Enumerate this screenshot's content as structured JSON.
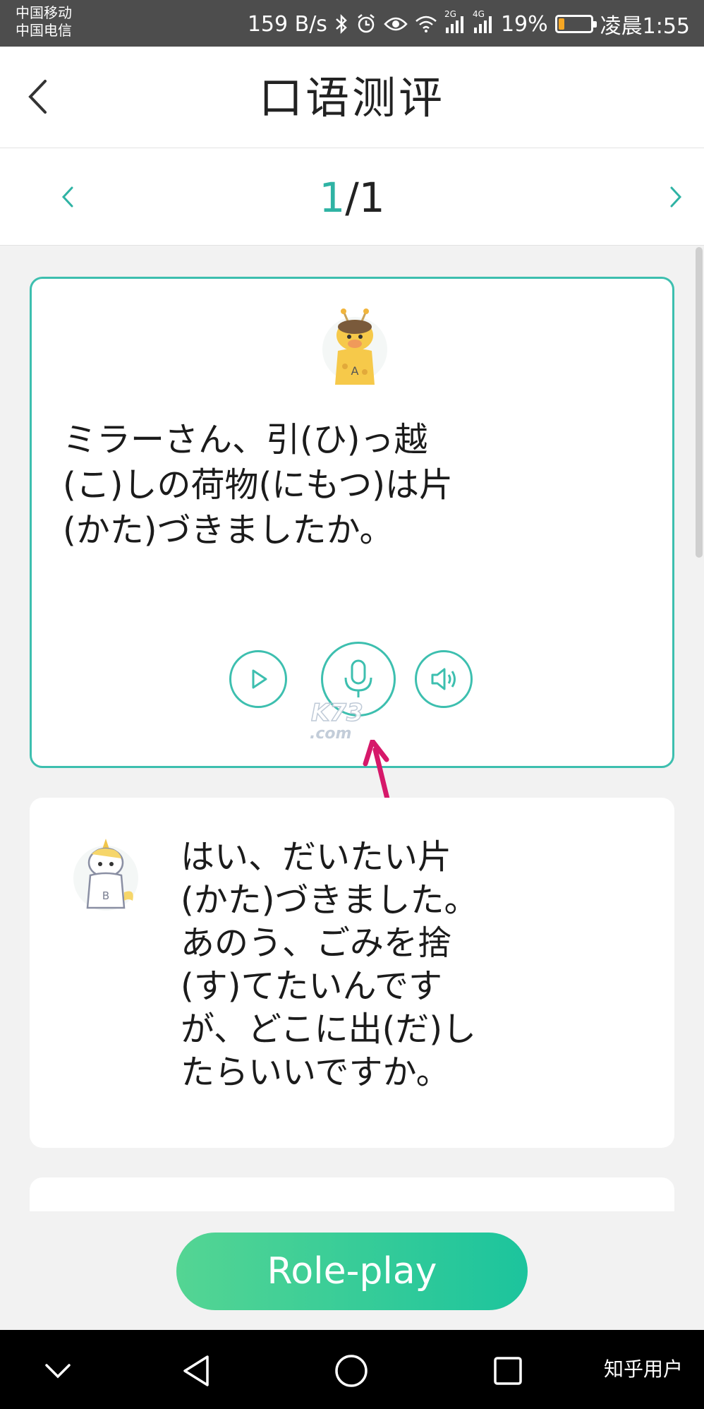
{
  "status_bar": {
    "carrier_1": "中国移动",
    "carrier_2": "中国电信",
    "speed": "159 B/s",
    "network_1": "2G",
    "network_2": "4G",
    "battery_percent": "19%",
    "battery_level": 0.19,
    "time": "凌晨1:55",
    "icons": [
      "bluetooth-icon",
      "alarm-icon",
      "eye-icon",
      "wifi-icon",
      "signal-icon",
      "battery-icon"
    ]
  },
  "header": {
    "title": "口语测评"
  },
  "pager": {
    "current": "1",
    "separator": "/",
    "total": "1"
  },
  "dialog": [
    {
      "speaker": "A",
      "text_lines": [
        "ミラーさん、引(ひ)っ越",
        "(こ)しの荷物(にもつ)は片",
        "(かた)づきましたか。"
      ],
      "selected": true
    },
    {
      "speaker": "B",
      "text_lines": [
        "はい、だいたい片",
        "(かた)づきました。",
        "あのう、ごみを捨",
        "(す)てたいんです",
        "が、どこに出(だ)し",
        "たらいいですか。"
      ],
      "selected": false
    }
  ],
  "controls": {
    "icons": [
      "play-icon",
      "microphone-icon",
      "speaker-icon"
    ]
  },
  "watermark": {
    "logo": "K73",
    "site": ".com"
  },
  "bottom": {
    "roleplay_label": "Role-play"
  },
  "nav": {
    "brand": "知乎用户"
  },
  "colors": {
    "accent": "#3dbfaf",
    "button_gradient_start": "#54d593",
    "button_gradient_end": "#1cc49d",
    "annotation_arrow": "#d6196a"
  }
}
